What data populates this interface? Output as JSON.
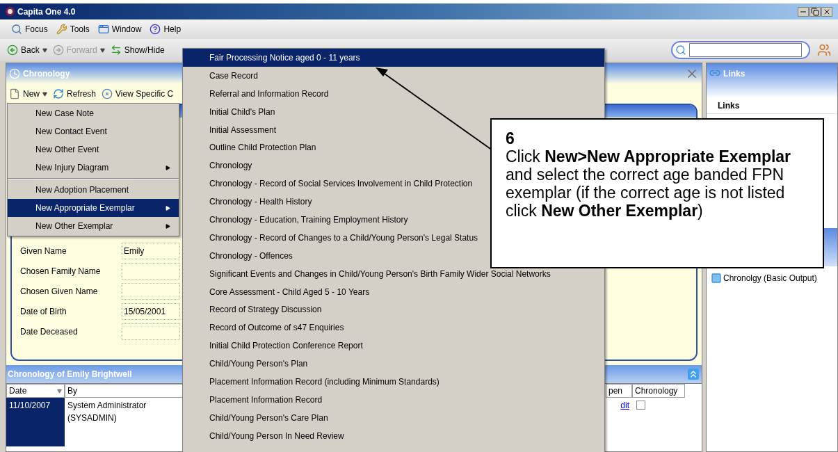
{
  "window": {
    "title": "Capita One 4.0"
  },
  "menu_bar": [
    {
      "label": "Focus"
    },
    {
      "label": "Tools"
    },
    {
      "label": "Window"
    },
    {
      "label": "Help"
    }
  ],
  "toolbar": [
    {
      "label": "Back",
      "disabled": false
    },
    {
      "label": "Forward",
      "disabled": true
    },
    {
      "label": "Show/Hide",
      "disabled": false
    }
  ],
  "chronology_panel": {
    "title": "Chronology",
    "toolbar": [
      {
        "label": "New",
        "dropdown": true
      },
      {
        "label": "Refresh",
        "dropdown": false
      },
      {
        "label": "View Specific C",
        "dropdown": false
      }
    ],
    "fields": [
      {
        "label": "Given Name",
        "value": "Emily"
      },
      {
        "label": "Chosen Family Name"
      },
      {
        "label": "Chosen Given Name"
      },
      {
        "label": "Date of Birth",
        "value": "15/05/2001"
      },
      {
        "label": "Date Deceased"
      }
    ],
    "list": {
      "title": "Chronology of Emily Brightwell",
      "columns": [
        "Date",
        "By",
        "pen",
        "Chronology"
      ],
      "rows": [
        {
          "date": "11/10/2007",
          "by": "System Administrator (SYSADMIN)",
          "open": "dit",
          "checked": false,
          "selected": true
        }
      ]
    }
  },
  "links_panel": {
    "title": "Links",
    "heading": "Links",
    "outputs": [
      {
        "label": "Chronolgy (Basic Output)"
      }
    ]
  },
  "new_menu": [
    {
      "kind": "item",
      "label": "New Case Note",
      "submenu": false,
      "selected": false
    },
    {
      "kind": "item",
      "label": "New Contact Event",
      "submenu": false,
      "selected": false
    },
    {
      "kind": "item",
      "label": "New Other Event",
      "submenu": false,
      "selected": false
    },
    {
      "kind": "item",
      "label": "New Injury Diagram",
      "submenu": true,
      "selected": false
    },
    {
      "kind": "separator"
    },
    {
      "kind": "item",
      "label": "New Adoption Placement",
      "submenu": false,
      "selected": false
    },
    {
      "kind": "item",
      "label": "New Appropriate Exemplar",
      "submenu": true,
      "selected": true
    },
    {
      "kind": "item",
      "label": "New Other Exemplar",
      "submenu": true,
      "selected": false
    }
  ],
  "exemplar_submenu": [
    {
      "label": "Fair Processing Notice aged 0 - 11 years",
      "selected": true
    },
    {
      "label": "Case Record",
      "selected": false
    },
    {
      "label": "Referral and Information Record",
      "selected": false
    },
    {
      "label": "Initial Child's Plan",
      "selected": false
    },
    {
      "label": "Initial Assessment",
      "selected": false
    },
    {
      "label": "Outline Child Protection Plan",
      "selected": false
    },
    {
      "label": "Chronology",
      "selected": false
    },
    {
      "label": "Chronology - Record of Social Services Involvement in Child Protection",
      "selected": false
    },
    {
      "label": "Chronology - Health History",
      "selected": false
    },
    {
      "label": "Chronology - Education, Training  Employment History",
      "selected": false
    },
    {
      "label": "Chronology - Record of Changes to a Child/Young Person's Legal Status",
      "selected": false
    },
    {
      "label": "Chronology - Offences",
      "selected": false
    },
    {
      "label": "Significant Events and Changes in Child/Young Person's Birth Family  Wider Social Networks",
      "selected": false
    },
    {
      "label": "Core Assessment - Child Aged 5 - 10 Years",
      "selected": false
    },
    {
      "label": "Record of Strategy Discussion",
      "selected": false
    },
    {
      "label": "Record of Outcome of s47 Enquiries",
      "selected": false
    },
    {
      "label": "Initial Child Protection Conference Report",
      "selected": false
    },
    {
      "label": "Child/Young Person's Plan",
      "selected": false
    },
    {
      "label": "Placement Information Record (including Minimum Standards)",
      "selected": false
    },
    {
      "label": "Placement Information Record",
      "selected": false
    },
    {
      "label": "Child/Young Person's Care Plan",
      "selected": false
    },
    {
      "label": "Child/Young Person In Need Review",
      "selected": false
    }
  ],
  "callout": {
    "step": "6",
    "text": "Click **New>New Appropriate Exemplar** and select the correct age banded FPN exemplar (if the correct age is not listed click **New Other Exemplar**)"
  }
}
